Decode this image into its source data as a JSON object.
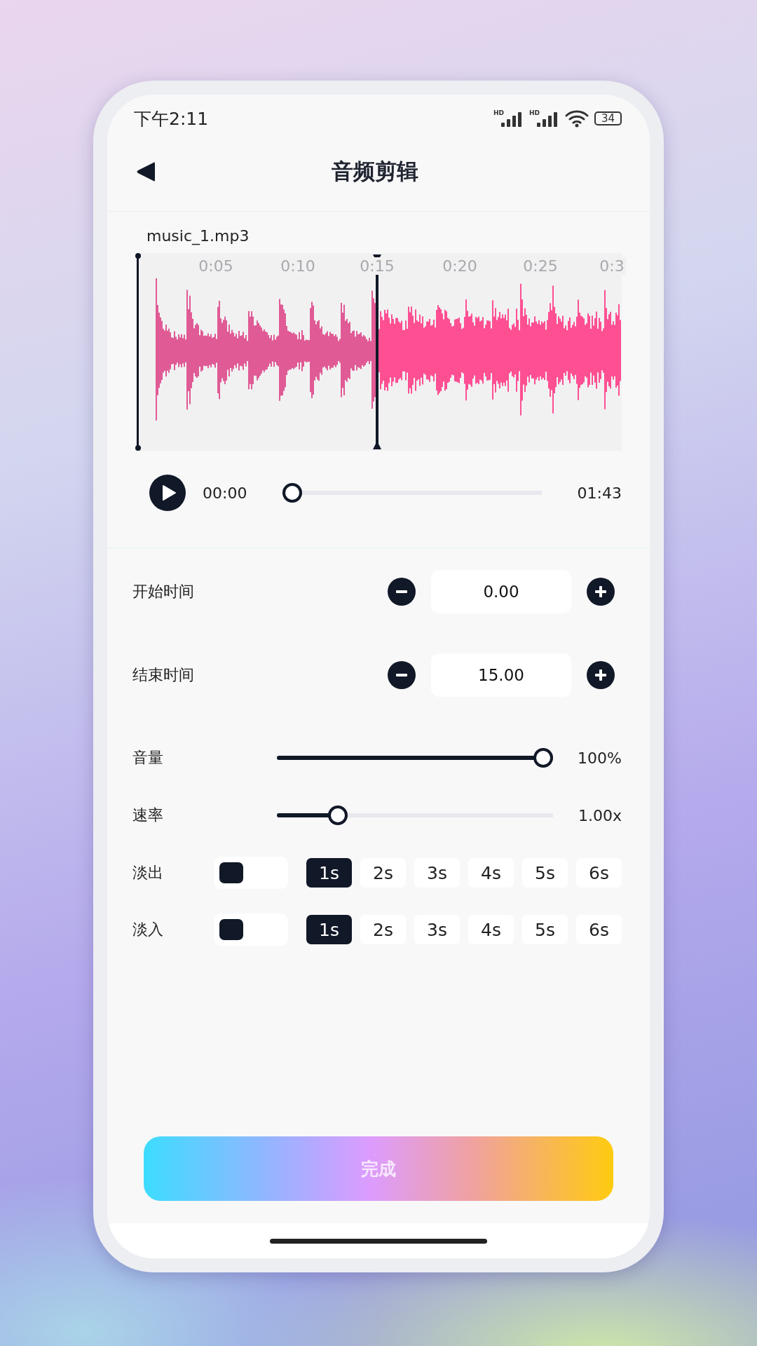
{
  "status_bar": {
    "time": "下午2:11",
    "network_labels": [
      "HD",
      "HD"
    ],
    "battery": "34"
  },
  "header": {
    "title": "音频剪辑"
  },
  "file": {
    "name": "music_1.mp3"
  },
  "waveform": {
    "ticks": [
      "0:05",
      "0:10",
      "0:15",
      "0:20",
      "0:25",
      "0:3"
    ]
  },
  "player": {
    "current": "00:00",
    "total": "01:43",
    "level": 0
  },
  "steppers": [
    {
      "label": "开始时间",
      "value": "0.00"
    },
    {
      "label": "结束时间",
      "value": "15.00"
    }
  ],
  "sliders": [
    {
      "label": "音量",
      "level": 1,
      "reading": "100%"
    },
    {
      "label": "速率",
      "level": 0.2,
      "reading": "1.00x"
    }
  ],
  "fades": [
    {
      "label": "淡出",
      "on": false,
      "options": [
        {
          "label": "1s",
          "selected": true
        },
        {
          "label": "2s",
          "selected": false
        },
        {
          "label": "3s",
          "selected": false
        },
        {
          "label": "4s",
          "selected": false
        },
        {
          "label": "5s",
          "selected": false
        },
        {
          "label": "6s",
          "selected": false
        }
      ]
    },
    {
      "label": "淡入",
      "on": false,
      "options": [
        {
          "label": "1s",
          "selected": true
        },
        {
          "label": "2s",
          "selected": false
        },
        {
          "label": "3s",
          "selected": false
        },
        {
          "label": "4s",
          "selected": false
        },
        {
          "label": "5s",
          "selected": false
        },
        {
          "label": "6s",
          "selected": false
        }
      ]
    }
  ],
  "done_button": {
    "label": "完成"
  }
}
